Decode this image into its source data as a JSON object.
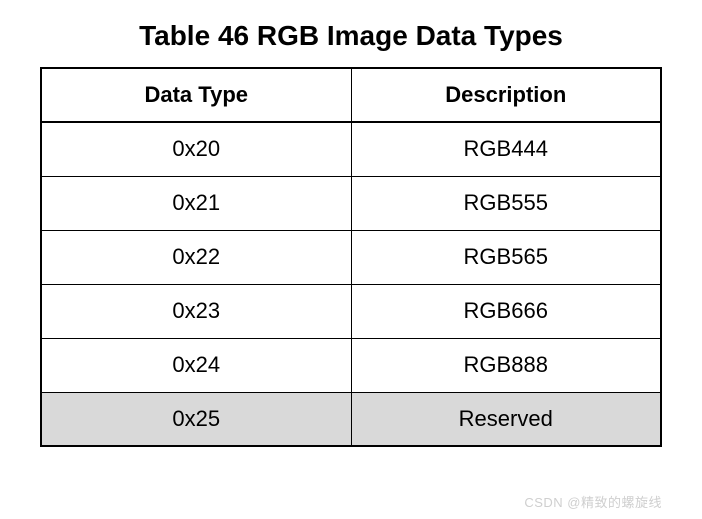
{
  "title": "Table 46 RGB Image Data Types",
  "headers": {
    "col0": "Data Type",
    "col1": "Description"
  },
  "rows": [
    {
      "col0": "0x20",
      "col1": "RGB444",
      "shaded": false
    },
    {
      "col0": "0x21",
      "col1": "RGB555",
      "shaded": false
    },
    {
      "col0": "0x22",
      "col1": "RGB565",
      "shaded": false
    },
    {
      "col0": "0x23",
      "col1": "RGB666",
      "shaded": false
    },
    {
      "col0": "0x24",
      "col1": "RGB888",
      "shaded": false
    },
    {
      "col0": "0x25",
      "col1": "Reserved",
      "shaded": true
    }
  ],
  "watermark": "CSDN @精致的螺旋线"
}
